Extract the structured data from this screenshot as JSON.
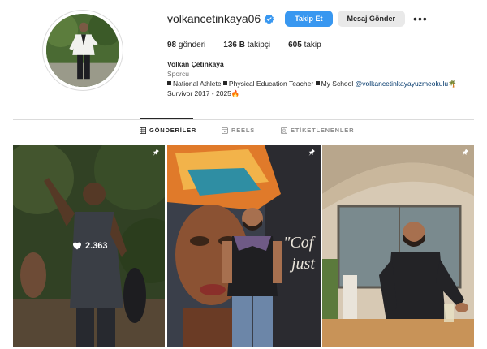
{
  "profile": {
    "username": "volkancetinkaya06",
    "follow_label": "Takip Et",
    "message_label": "Mesaj Gönder",
    "more_label": "•••",
    "stats": {
      "posts_count": "98",
      "posts_label": "gönderi",
      "followers_count": "136 B",
      "followers_label": "takipçi",
      "following_count": "605",
      "following_label": "takip"
    },
    "bio": {
      "name": "Volkan Çetinkaya",
      "category": "Sporcu",
      "line1_a": "National Athlete",
      "line1_b": "Physical Education Teacher",
      "line1_c": "My School",
      "mention": "@volkancetinkayayuzmeokulu",
      "mention_emoji": "🌴",
      "line2": "Survivor 2017 - 2025",
      "line2_emoji": "🔥"
    }
  },
  "tabs": [
    {
      "label": "GÖNDERİLER"
    },
    {
      "label": "REELS"
    },
    {
      "label": "ETİKETLENENLER"
    }
  ],
  "posts": [
    {
      "likes": "2.363",
      "pinned": true
    },
    {
      "overlay_text_1": "\"Cof",
      "overlay_text_2": "just",
      "pinned": true
    },
    {
      "pinned": true
    }
  ],
  "colors": {
    "follow_button": "#3897f0",
    "message_button": "#e9e9e9",
    "verified_badge": "#3897f0",
    "mention_link": "#00376b"
  }
}
